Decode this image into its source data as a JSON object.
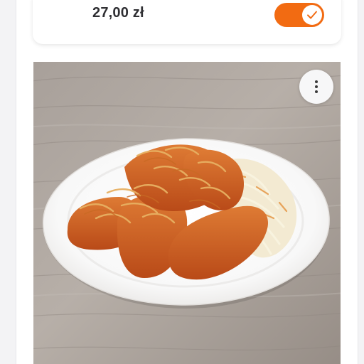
{
  "product": {
    "price": "27,00 zł",
    "enabled": true
  },
  "colors": {
    "accent": "#f26b12",
    "card": "#ffffff",
    "text": "#2f2f33"
  },
  "icons": {
    "toggle_check": "checkmark-icon",
    "more": "more-vertical-icon"
  },
  "photo": {
    "subject": "dish-photo"
  }
}
